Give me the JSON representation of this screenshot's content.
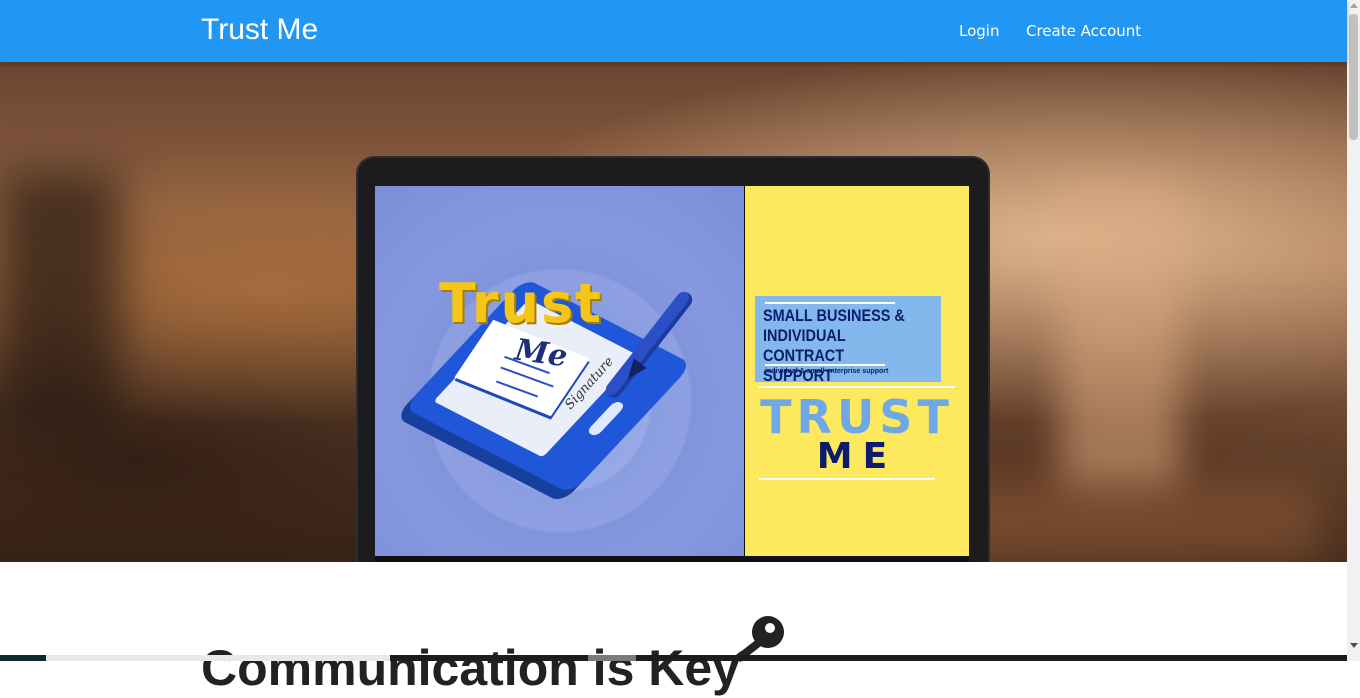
{
  "navbar": {
    "brand": "Trust Me",
    "links": [
      {
        "label": "Login"
      },
      {
        "label": "Create Account"
      }
    ],
    "color": "#2196f3"
  },
  "hero": {
    "poster": {
      "left_title": "Trust",
      "left_me": "Me",
      "signature": "Signature",
      "info_title": "SMALL BUSINESS & INDIVIDUAL CONTRACT SUPPORT",
      "info_subtitle": "individual & small enterprise support",
      "brand_line_1": "TRUST",
      "brand_line_2": "ME"
    }
  },
  "content": {
    "heading": "Communication is Key",
    "heading_icon": "key-icon"
  },
  "colors": {
    "poster_yellow": "#fce95e",
    "poster_blue": "#8093dc",
    "dark_navy": "#0d1c6e"
  }
}
